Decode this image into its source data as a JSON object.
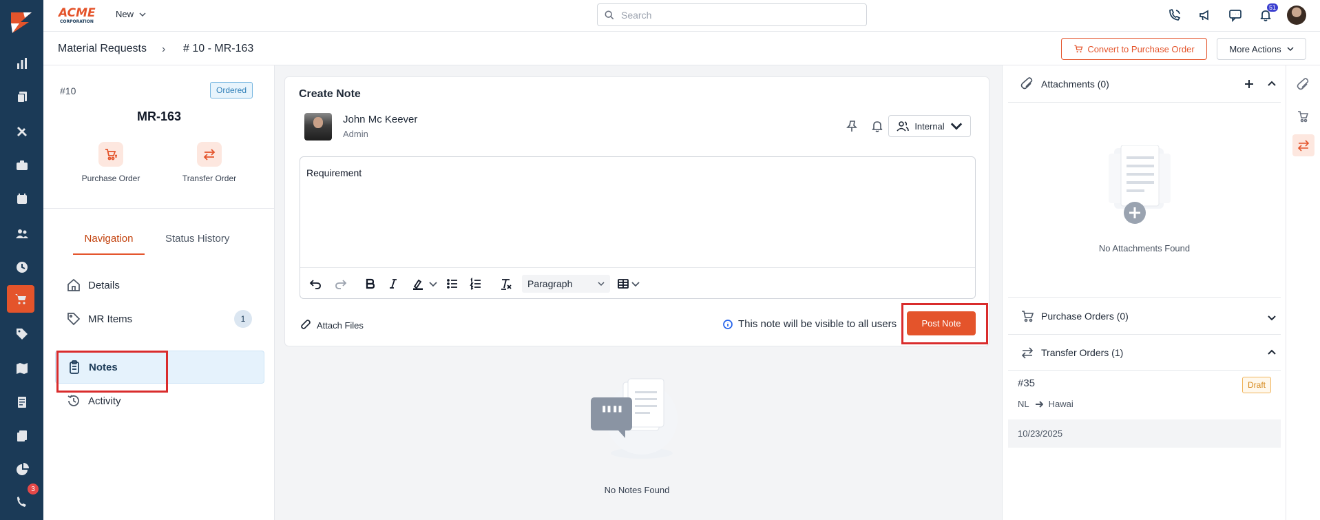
{
  "brand": {
    "logo_text": "ACME",
    "logo_sub": "CORPORATION",
    "accent": "#e4542b",
    "rail_bg": "#1b3a57"
  },
  "topbar": {
    "new_label": "New",
    "search_placeholder": "Search",
    "notifications_count": "51"
  },
  "rail": {
    "items": [
      "dashboard-icon",
      "documents-icon",
      "tools-icon",
      "briefcase-icon",
      "calendar-icon",
      "users-icon",
      "clock-icon",
      "cart-icon",
      "tag-icon",
      "map-icon",
      "invoice-icon",
      "files-icon",
      "pie-chart-icon",
      "phone-chat-icon"
    ],
    "active": "cart-icon",
    "chat_badge": "3"
  },
  "breadcrumb": {
    "parent": "Material Requests",
    "current": "# 10 - MR-163",
    "separator": "›"
  },
  "header_actions": {
    "convert_label": "Convert to Purchase Order",
    "more_label": "More Actions"
  },
  "record": {
    "number": "#10",
    "status": "Ordered",
    "title": "MR-163",
    "quick_actions": [
      {
        "label": "Purchase Order"
      },
      {
        "label": "Transfer Order"
      }
    ]
  },
  "left_tabs": {
    "navigation": "Navigation",
    "status_history": "Status History"
  },
  "nav": {
    "details": "Details",
    "mr_items": "MR Items",
    "mr_items_count": "1",
    "notes": "Notes",
    "activity": "Activity"
  },
  "note": {
    "title": "Create Note",
    "user_name": "John Mc Keever",
    "user_role": "Admin",
    "visibility": "Internal",
    "content": "Requirement",
    "paragraph_style": "Paragraph",
    "attach_label": "Attach Files",
    "visibility_info": "This note will be visible to all users",
    "post_label": "Post Note"
  },
  "notes_empty": "No Notes Found",
  "right": {
    "attachments_title": "Attachments (0)",
    "attachments_empty": "No Attachments Found",
    "purchase_orders_title": "Purchase Orders (0)",
    "transfer_orders_title": "Transfer Orders (1)",
    "transfer_order": {
      "number": "#35",
      "status": "Draft",
      "from": "NL",
      "to": "Hawai",
      "date": "10/23/2025"
    }
  }
}
